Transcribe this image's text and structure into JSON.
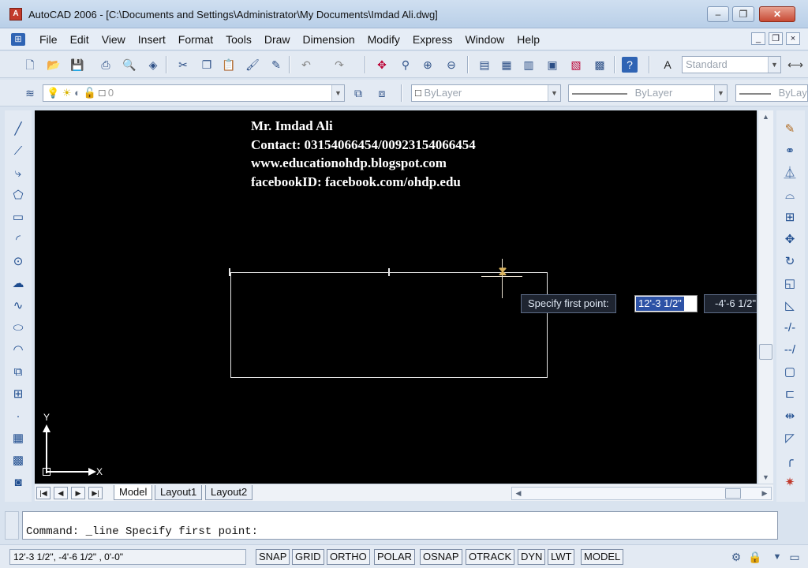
{
  "window": {
    "title": "AutoCAD 2006 - [C:\\Documents and Settings\\Administrator\\My Documents\\Imdad Ali.dwg]",
    "controls": {
      "minimize": "–",
      "restore": "❐",
      "close": "✕"
    }
  },
  "menu": {
    "items": [
      "File",
      "Edit",
      "View",
      "Insert",
      "Format",
      "Tools",
      "Draw",
      "Dimension",
      "Modify",
      "Express",
      "Window",
      "Help"
    ],
    "mdi_controls": [
      "_",
      "❐",
      "×"
    ]
  },
  "standard_toolbar": {
    "text_style": "Standard"
  },
  "layers_toolbar": {
    "current_layer": "0",
    "color": "ByLayer",
    "linetype": "ByLayer",
    "lineweight": "ByLay"
  },
  "canvas": {
    "watermark_lines": [
      "Mr. Imdad Ali",
      "Contact: 03154066454/00923154066454",
      "www.educationohdp.blogspot.com",
      "facebookID: facebook.com/ohdp.edu"
    ],
    "dynamic_input": {
      "prompt": "Specify first point:",
      "value_x": "12'-3 1/2\"",
      "value_y": "-4'-6 1/2\""
    },
    "ucs": {
      "x_label": "X",
      "y_label": "Y"
    }
  },
  "tabs": {
    "items": [
      "Model",
      "Layout1",
      "Layout2"
    ],
    "active": "Model"
  },
  "command_line": {
    "text": "Command: _line Specify first point:"
  },
  "status_bar": {
    "coordinates": "12'-3 1/2\",  -4'-6 1/2\" , 0'-0\"",
    "buttons": [
      "SNAP",
      "GRID",
      "ORTHO",
      "POLAR",
      "OSNAP",
      "OTRACK",
      "DYN",
      "LWT",
      "MODEL"
    ]
  },
  "colors": {
    "canvas_bg": "#000000",
    "drawing_lines": "#e6e6e6",
    "dynamic_input_highlight": "#2d52a6"
  },
  "icons": {
    "standard": [
      "new-icon",
      "open-icon",
      "save-icon",
      "plot-icon",
      "plot-preview-icon",
      "publish-icon",
      "cut-icon",
      "copy-icon",
      "paste-icon",
      "match-properties-icon",
      "block-editor-icon",
      "undo-icon",
      "redo-icon",
      "pan-icon",
      "zoom-realtime-icon",
      "zoom-window-icon",
      "zoom-previous-icon",
      "properties-icon",
      "design-center-icon",
      "tool-palettes-icon",
      "sheet-set-icon",
      "markup-icon",
      "quickcalc-icon",
      "help-icon",
      "text-style-icon"
    ],
    "draw": [
      "line-icon",
      "construction-line-icon",
      "polyline-icon",
      "polygon-icon",
      "rectangle-icon",
      "arc-icon",
      "circle-icon",
      "revision-cloud-icon",
      "spline-icon",
      "ellipse-icon",
      "ellipse-arc-icon",
      "insert-block-icon",
      "make-block-icon",
      "point-icon",
      "hatch-icon",
      "gradient-icon",
      "region-icon"
    ],
    "modify": [
      "erase-icon",
      "copy-object-icon",
      "mirror-icon",
      "offset-icon",
      "array-icon",
      "move-icon",
      "rotate-icon",
      "scale-icon",
      "stretch-icon",
      "trim-icon",
      "extend-icon",
      "break-at-point-icon",
      "break-icon",
      "join-icon",
      "chamfer-icon",
      "fillet-icon",
      "explode-icon"
    ]
  }
}
